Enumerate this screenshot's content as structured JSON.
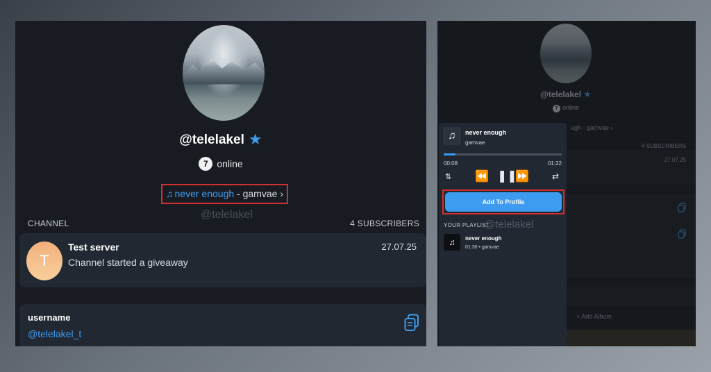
{
  "left": {
    "username": "@telelakel",
    "online_badge": "7",
    "online_text": "online",
    "song": {
      "title": "never enough",
      "separator": " - ",
      "artist": "gamvae",
      "chevron": "›"
    },
    "watermark": "@telelakel",
    "channel_label": "CHANNEL",
    "subscribers_label": "4 SUBSCRIBERS",
    "channel_card": {
      "avatar_letter": "T",
      "title": "Test server",
      "subtitle": "Channel started a giveaway",
      "date": "27.07.25"
    },
    "info_card": {
      "label": "username",
      "value": "@telelakel_t"
    }
  },
  "right": {
    "background": {
      "username": "@telelakel",
      "online_badge": "7",
      "online_text": "online",
      "song_fragment": "ugh - gamvae ›",
      "subscribers": "4 SUBSCRIBERS",
      "date": "27.07.25",
      "add_album": "+ Add Album"
    },
    "player": {
      "title": "never enough",
      "artist": "gamvae",
      "time_current": "00:08",
      "time_total": "01:22",
      "progress": 0.1,
      "add_button": "Add To Profile",
      "playlist_label": "YOUR PLAYLIST",
      "watermark": "@telelakel",
      "playlist": [
        {
          "title": "never enough",
          "meta": "01:30 • gamvae"
        }
      ]
    }
  },
  "colors": {
    "accent": "#3e9cf0",
    "highlight_border": "#d2302f",
    "card_bg": "#212832",
    "panel_bg": "#181c22"
  },
  "icons": [
    "star-icon",
    "music-note-icon",
    "chevron-right-icon",
    "copy-icon",
    "sort-icon",
    "previous-icon",
    "pause-icon",
    "next-icon",
    "repeat-icon"
  ]
}
